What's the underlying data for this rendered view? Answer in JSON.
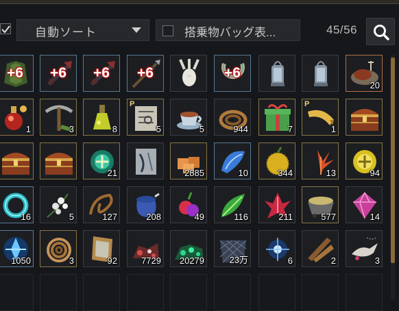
{
  "header": {
    "sort_label": "自動ソート",
    "filter_label": "搭乗物バッグ表...",
    "count": "45/56"
  },
  "grid": {
    "rows": [
      [
        {
          "icon": "green-cloak-icon",
          "border": "blue",
          "enh": "+6",
          "qty": ""
        },
        {
          "icon": "dark-weapon-icon",
          "border": "blue",
          "enh": "+6",
          "qty": ""
        },
        {
          "icon": "dark-weapon-icon",
          "border": "blue",
          "enh": "+6",
          "qty": ""
        },
        {
          "icon": "spear-icon",
          "border": "blue",
          "enh": "+6",
          "qty": ""
        },
        {
          "icon": "white-radish-icon",
          "border": "plain",
          "enh": "",
          "qty": ""
        },
        {
          "icon": "horseshoe-icon",
          "border": "blue",
          "enh": "+6",
          "qty": ""
        },
        {
          "icon": "lantern-icon",
          "border": "plain",
          "enh": "",
          "qty": ""
        },
        {
          "icon": "lantern-icon",
          "border": "plain",
          "enh": "",
          "qty": ""
        },
        {
          "icon": "meat-dish-icon",
          "border": "orange",
          "enh": "",
          "qty": "20"
        }
      ],
      [
        {
          "icon": "red-elixir-icon",
          "border": "gold",
          "enh": "",
          "qty": "1"
        },
        {
          "icon": "pickaxe-icon",
          "border": "gold",
          "enh": "",
          "qty": "3"
        },
        {
          "icon": "yellow-potion-icon",
          "border": "gold",
          "enh": "",
          "qty": "8"
        },
        {
          "icon": "map-scroll-icon",
          "border": "gold",
          "enh": "",
          "qty": "5",
          "tag": "P"
        },
        {
          "icon": "tea-cup-icon",
          "border": "plain",
          "enh": "",
          "qty": "5"
        },
        {
          "icon": "rope-icon",
          "border": "plain",
          "enh": "",
          "qty": "944"
        },
        {
          "icon": "gift-box-icon",
          "border": "gold",
          "enh": "",
          "qty": "7"
        },
        {
          "icon": "horn-icon",
          "border": "gold",
          "enh": "",
          "qty": "1",
          "tag": "P"
        },
        {
          "icon": "treasure-chest-icon",
          "border": "gold",
          "enh": "",
          "qty": ""
        }
      ],
      [
        {
          "icon": "treasure-chest-icon",
          "border": "gold",
          "enh": "",
          "qty": ""
        },
        {
          "icon": "treasure-chest-icon",
          "border": "gold",
          "enh": "",
          "qty": ""
        },
        {
          "icon": "green-orb-icon",
          "border": "gold",
          "enh": "",
          "qty": "21"
        },
        {
          "icon": "fish-scroll-icon",
          "border": "plain",
          "enh": "",
          "qty": ""
        },
        {
          "icon": "orange-cubes-icon",
          "border": "gold",
          "enh": "",
          "qty": "2885"
        },
        {
          "icon": "blue-shell-icon",
          "border": "blue",
          "enh": "",
          "qty": "10"
        },
        {
          "icon": "yellow-fruit-icon",
          "border": "gold",
          "enh": "",
          "qty": "344"
        },
        {
          "icon": "orange-flower-icon",
          "border": "gold",
          "enh": "",
          "qty": "13"
        },
        {
          "icon": "gold-coin-icon",
          "border": "gold",
          "enh": "",
          "qty": "94"
        }
      ],
      [
        {
          "icon": "teal-ring-icon",
          "border": "blue",
          "enh": "",
          "qty": "16"
        },
        {
          "icon": "white-flower-icon",
          "border": "plain",
          "enh": "",
          "qty": "5"
        },
        {
          "icon": "vine-icon",
          "border": "plain",
          "enh": "",
          "qty": "127"
        },
        {
          "icon": "blue-jar-icon",
          "border": "plain",
          "enh": "",
          "qty": "208"
        },
        {
          "icon": "berry-icon",
          "border": "plain",
          "enh": "",
          "qty": "49"
        },
        {
          "icon": "green-leaf-icon",
          "border": "plain",
          "enh": "",
          "qty": "116"
        },
        {
          "icon": "red-crystal-icon",
          "border": "plain",
          "enh": "",
          "qty": "211"
        },
        {
          "icon": "ore-cart-icon",
          "border": "gold",
          "enh": "",
          "qty": "577"
        },
        {
          "icon": "pink-gem-icon",
          "border": "plain",
          "enh": "",
          "qty": "14"
        }
      ],
      [
        {
          "icon": "blue-crystal-icon",
          "border": "blue",
          "enh": "",
          "qty": "1050"
        },
        {
          "icon": "rope-coil-icon",
          "border": "gold",
          "enh": "",
          "qty": "3"
        },
        {
          "icon": "mirror-frame-icon",
          "border": "plain",
          "enh": "",
          "qty": "92"
        },
        {
          "icon": "red-ore-icon",
          "border": "plain",
          "enh": "",
          "qty": "7729"
        },
        {
          "icon": "green-ore-icon",
          "border": "plain",
          "enh": "",
          "qty": "20279"
        },
        {
          "icon": "net-icon",
          "border": "plain",
          "enh": "",
          "qty": "23万"
        },
        {
          "icon": "sparkle-orb-icon",
          "border": "plain",
          "enh": "",
          "qty": "6"
        },
        {
          "icon": "wood-planks-icon",
          "border": "plain",
          "enh": "",
          "qty": "2"
        },
        {
          "icon": "bird-charm-icon",
          "border": "plain",
          "enh": "",
          "qty": "3"
        }
      ]
    ]
  }
}
